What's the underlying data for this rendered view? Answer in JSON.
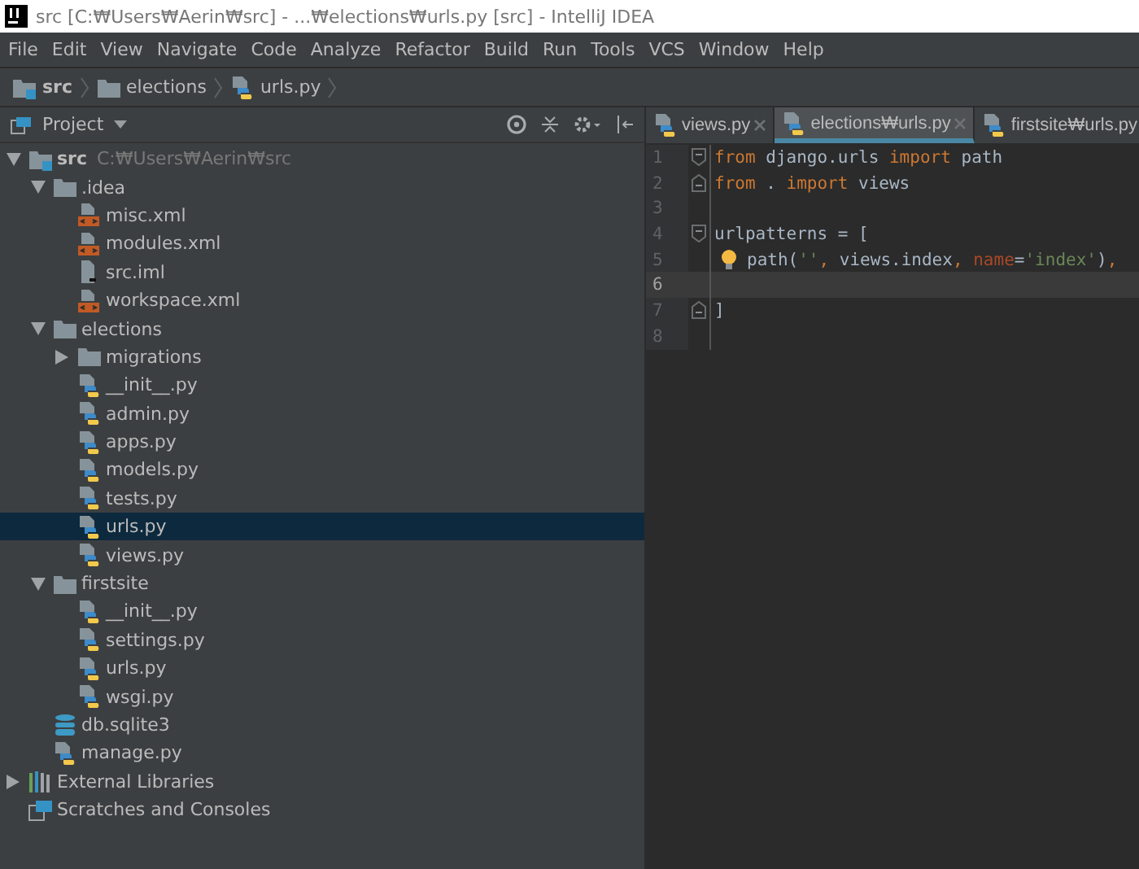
{
  "window": {
    "title": "src [C:₩Users₩Aerin₩src] - ...₩elections₩urls.py [src] - IntelliJ IDEA"
  },
  "menu": [
    "File",
    "Edit",
    "View",
    "Navigate",
    "Code",
    "Analyze",
    "Refactor",
    "Build",
    "Run",
    "Tools",
    "VCS",
    "Window",
    "Help"
  ],
  "breadcrumbs": [
    {
      "kind": "source-root",
      "label": "src"
    },
    {
      "kind": "folder",
      "label": "elections"
    },
    {
      "kind": "python",
      "label": "urls.py"
    }
  ],
  "project_panel": {
    "title": "Project"
  },
  "tree": [
    {
      "kind": "source-root",
      "label": "src",
      "path": "C:₩Users₩Aerin₩src",
      "expanded": true,
      "selected": false,
      "children": [
        {
          "kind": "folder",
          "label": ".idea",
          "expanded": true,
          "selected": false,
          "children": [
            {
              "kind": "xml",
              "label": "misc.xml",
              "selected": false
            },
            {
              "kind": "xml",
              "label": "modules.xml",
              "selected": false
            },
            {
              "kind": "iml",
              "label": "src.iml",
              "selected": false
            },
            {
              "kind": "xml",
              "label": "workspace.xml",
              "selected": false
            }
          ]
        },
        {
          "kind": "folder",
          "label": "elections",
          "expanded": true,
          "selected": false,
          "children": [
            {
              "kind": "folder",
              "label": "migrations",
              "expanded": false,
              "selected": false
            },
            {
              "kind": "python",
              "label": "__init__.py",
              "selected": false
            },
            {
              "kind": "python",
              "label": "admin.py",
              "selected": false
            },
            {
              "kind": "python",
              "label": "apps.py",
              "selected": false
            },
            {
              "kind": "python",
              "label": "models.py",
              "selected": false
            },
            {
              "kind": "python",
              "label": "tests.py",
              "selected": false
            },
            {
              "kind": "python",
              "label": "urls.py",
              "selected": true
            },
            {
              "kind": "python",
              "label": "views.py",
              "selected": false
            }
          ]
        },
        {
          "kind": "folder",
          "label": "firstsite",
          "expanded": true,
          "selected": false,
          "children": [
            {
              "kind": "python",
              "label": "__init__.py",
              "selected": false
            },
            {
              "kind": "python",
              "label": "settings.py",
              "selected": false
            },
            {
              "kind": "python",
              "label": "urls.py",
              "selected": false
            },
            {
              "kind": "python",
              "label": "wsgi.py",
              "selected": false
            }
          ]
        },
        {
          "kind": "db",
          "label": "db.sqlite3",
          "selected": false
        },
        {
          "kind": "python",
          "label": "manage.py",
          "selected": false
        }
      ]
    },
    {
      "kind": "libraries",
      "label": "External Libraries",
      "expanded": false,
      "selected": false
    },
    {
      "kind": "scratches",
      "label": "Scratches and Consoles",
      "selected": false
    }
  ],
  "tabs": [
    {
      "label": "views.py",
      "selected": false
    },
    {
      "label": "elections₩urls.py",
      "selected": true
    },
    {
      "label": "firstsite₩urls.py",
      "selected": false
    }
  ],
  "code": [
    {
      "number": "1",
      "fold_start": true,
      "fold_end": false,
      "bulb": false,
      "current": false,
      "tokens": [
        {
          "kind": "keyword",
          "text": "from"
        },
        {
          "kind": "plain",
          "text": " django.urls "
        },
        {
          "kind": "keyword",
          "text": "import"
        },
        {
          "kind": "plain",
          "text": " path"
        }
      ]
    },
    {
      "number": "2",
      "fold_start": false,
      "fold_end": true,
      "bulb": false,
      "current": false,
      "tokens": [
        {
          "kind": "keyword",
          "text": "from"
        },
        {
          "kind": "plain",
          "text": " . "
        },
        {
          "kind": "keyword",
          "text": "import"
        },
        {
          "kind": "plain",
          "text": " views"
        }
      ]
    },
    {
      "number": "3",
      "fold_start": false,
      "fold_end": false,
      "bulb": false,
      "current": false
    },
    {
      "number": "4",
      "fold_start": true,
      "fold_end": false,
      "bulb": false,
      "current": false,
      "tokens": [
        {
          "kind": "plain",
          "text": "urlpatterns = ["
        }
      ]
    },
    {
      "number": "5",
      "fold_start": false,
      "fold_end": false,
      "bulb": true,
      "current": false,
      "tokens": [
        {
          "kind": "plain",
          "text": "path("
        },
        {
          "kind": "string",
          "text": "''"
        },
        {
          "kind": "keyword",
          "text": ","
        },
        {
          "kind": "plain",
          "text": " views.index"
        },
        {
          "kind": "keyword",
          "text": ", "
        },
        {
          "kind": "param",
          "text": "name"
        },
        {
          "kind": "plain",
          "text": "="
        },
        {
          "kind": "string",
          "text": "'index'"
        },
        {
          "kind": "plain",
          "text": ")"
        },
        {
          "kind": "keyword",
          "text": ","
        }
      ]
    },
    {
      "number": "6",
      "fold_start": false,
      "fold_end": false,
      "bulb": false,
      "current": true
    },
    {
      "number": "7",
      "fold_start": false,
      "fold_end": true,
      "bulb": false,
      "current": false,
      "tokens": [
        {
          "kind": "plain",
          "text": "]"
        }
      ]
    },
    {
      "number": "8",
      "fold_start": false,
      "fold_end": false,
      "bulb": false,
      "current": false
    }
  ]
}
